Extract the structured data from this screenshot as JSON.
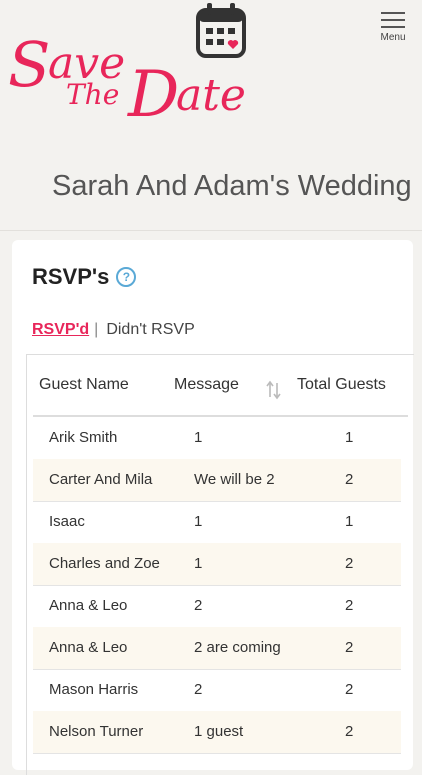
{
  "header": {
    "logo_text": "Save The Date",
    "menu_label": "Menu",
    "wedding_title": "Sarah And Adam's Wedding"
  },
  "rsvp": {
    "title": "RSVP's",
    "help_icon": "question-circle-icon",
    "tabs": [
      {
        "label": "RSVP'd",
        "active": true
      },
      {
        "label": "Didn't RSVP",
        "active": false
      }
    ],
    "tab_separator": "|",
    "columns": [
      "Guest Name",
      "Message",
      "Total Guests"
    ],
    "rows": [
      {
        "name": "Arik Smith",
        "message": "1",
        "total": "1"
      },
      {
        "name": "Carter And Mila",
        "message": "We will be 2",
        "total": "2"
      },
      {
        "name": "Isaac",
        "message": "1",
        "total": "1"
      },
      {
        "name": "Charles and Zoe",
        "message": "1",
        "total": "2"
      },
      {
        "name": "Anna & Leo",
        "message": "2",
        "total": "2"
      },
      {
        "name": "Anna & Leo",
        "message": "2 are coming",
        "total": "2"
      },
      {
        "name": "Mason Harris",
        "message": "2",
        "total": "2"
      },
      {
        "name": "Nelson Turner",
        "message": "1 guest",
        "total": "2"
      }
    ]
  },
  "colors": {
    "brand_pink": "#e8265a",
    "help_blue": "#5aa9d6",
    "row_alt": "#fcf8ef"
  }
}
